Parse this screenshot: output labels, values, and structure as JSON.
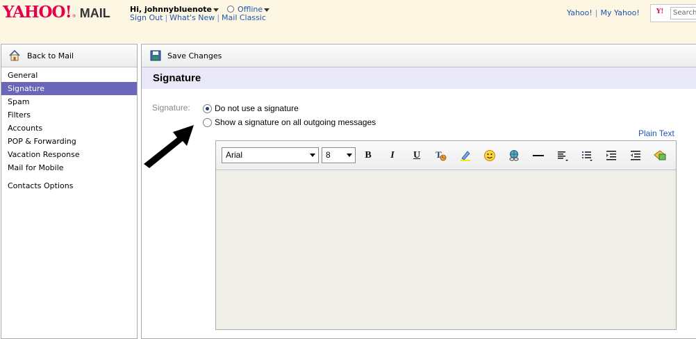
{
  "header": {
    "logo_text": "YAHOO!",
    "logo_suffix": "MAIL",
    "greeting": "Hi, johnnybluenote",
    "status": "Offline",
    "links": [
      "Sign Out",
      "What's New",
      "Mail Classic"
    ],
    "right_links": [
      "Yahoo!",
      "My Yahoo!"
    ],
    "search_placeholder": "Search"
  },
  "sidebar": {
    "back_label": "Back to Mail",
    "items": [
      {
        "label": "General"
      },
      {
        "label": "Signature"
      },
      {
        "label": "Spam"
      },
      {
        "label": "Filters"
      },
      {
        "label": "Accounts"
      },
      {
        "label": "POP & Forwarding"
      },
      {
        "label": "Vacation Response"
      },
      {
        "label": "Mail for Mobile"
      },
      {
        "label": "Contacts Options"
      }
    ],
    "active": "Signature"
  },
  "main": {
    "save_label": "Save Changes",
    "section_title": "Signature",
    "field_label": "Signature:",
    "options": [
      {
        "label": "Do not use a signature",
        "checked": true
      },
      {
        "label": "Show a signature on all outgoing messages",
        "checked": false
      }
    ],
    "plain_text_link": "Plain Text",
    "editor": {
      "font": "Arial",
      "size": "8",
      "tools": [
        "bold-icon",
        "italic-icon",
        "underline-icon",
        "text-color-icon",
        "highlight-icon",
        "emoticon-icon",
        "link-icon",
        "horizontal-rule-icon",
        "align-icon",
        "bullet-list-icon",
        "indent-icon",
        "outdent-icon",
        "insert-image-icon"
      ]
    }
  },
  "colors": {
    "brand": "#e4004a",
    "link": "#1f56b0",
    "active_nav": "#6a67ba",
    "title_bar": "#e9e8f8",
    "header_bg": "#fdf6e3"
  }
}
